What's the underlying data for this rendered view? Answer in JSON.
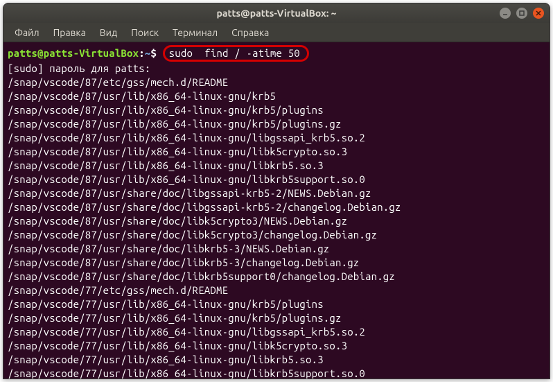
{
  "titlebar": {
    "title": "patts@patts-VirtualBox: ~"
  },
  "menubar": {
    "items": [
      "Файл",
      "Правка",
      "Вид",
      "Поиск",
      "Терминал",
      "Справка"
    ]
  },
  "prompt": {
    "user_host": "patts@patts-VirtualBox",
    "colon": ":",
    "path": "~",
    "dollar": "$"
  },
  "command": "sudo  find / -atime 50",
  "output_lines": [
    "[sudo] пароль для patts:",
    "/snap/vscode/87/etc/gss/mech.d/README",
    "/snap/vscode/87/usr/lib/x86_64-linux-gnu/krb5",
    "/snap/vscode/87/usr/lib/x86_64-linux-gnu/krb5/plugins",
    "/snap/vscode/87/usr/lib/x86_64-linux-gnu/krb5/plugins.gz",
    "/snap/vscode/87/usr/lib/x86_64-linux-gnu/libgssapi_krb5.so.2",
    "/snap/vscode/87/usr/lib/x86_64-linux-gnu/libk5crypto.so.3",
    "/snap/vscode/87/usr/lib/x86_64-linux-gnu/libkrb5.so.3",
    "/snap/vscode/87/usr/lib/x86_64-linux-gnu/libkrb5support.so.0",
    "/snap/vscode/87/usr/share/doc/libgssapi-krb5-2/NEWS.Debian.gz",
    "/snap/vscode/87/usr/share/doc/libgssapi-krb5-2/changelog.Debian.gz",
    "/snap/vscode/87/usr/share/doc/libk5crypto3/NEWS.Debian.gz",
    "/snap/vscode/87/usr/share/doc/libk5crypto3/changelog.Debian.gz",
    "/snap/vscode/87/usr/share/doc/libkrb5-3/NEWS.Debian.gz",
    "/snap/vscode/87/usr/share/doc/libkrb5-3/changelog.Debian.gz",
    "/snap/vscode/87/usr/share/doc/libkrb5support0/changelog.Debian.gz",
    "/snap/vscode/77/etc/gss/mech.d/README",
    "/snap/vscode/77/usr/lib/x86_64-linux-gnu/krb5/plugins",
    "/snap/vscode/77/usr/lib/x86_64-linux-gnu/krb5/plugins.gz",
    "/snap/vscode/77/usr/lib/x86_64-linux-gnu/libgssapi_krb5.so.2",
    "/snap/vscode/77/usr/lib/x86_64-linux-gnu/libk5crypto.so.3",
    "/snap/vscode/77/usr/lib/x86_64-linux-gnu/libkrb5.so.3",
    "/snap/vscode/77/usr/lib/x86_64-linux-gnu/libkrb5support.so.0"
  ]
}
